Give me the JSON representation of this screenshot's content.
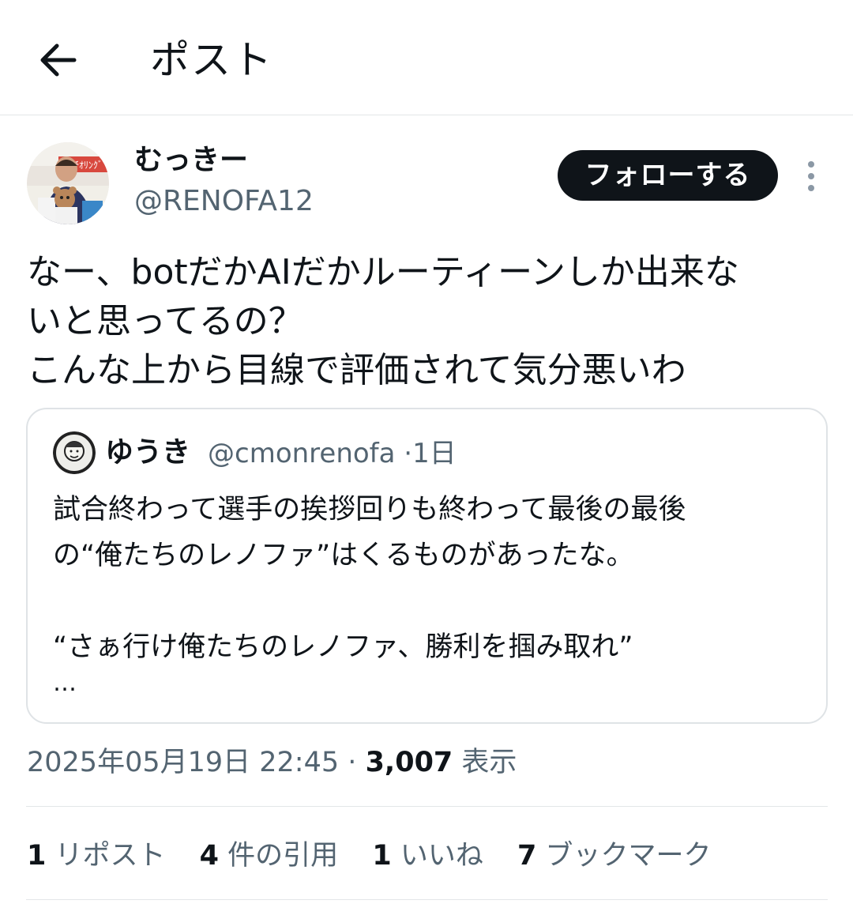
{
  "header": {
    "title": "ポスト",
    "back_icon": "arrow-left-icon"
  },
  "post": {
    "author": {
      "display_name": "むっきー",
      "handle": "@RENOFA12"
    },
    "follow_label": "フォローする",
    "more_icon": "more-vertical-icon",
    "text": "なー、botだかAIだかルーティーンしか出来な\nいと思ってるの？\nこんな上から目線で評価されて気分悪いわ",
    "quote": {
      "display_name": "ゆうき",
      "handle": "@cmonrenofa",
      "time": "1日",
      "separator": "·",
      "text": "試合終わって選手の挨拶回りも終わって最後の最後\nの“俺たちのレノファ”はくるものがあったな。\n\n“さぁ行け俺たちのレノファ、勝利を掴み取れ”",
      "ellipsis": "…"
    },
    "timestamp": "2025年05月19日 22:45",
    "separator": "·",
    "views_count": "3,007",
    "views_label": "表示",
    "stats": [
      {
        "count": "1",
        "label": "リポスト"
      },
      {
        "count": "4",
        "label": "件の引用"
      },
      {
        "count": "1",
        "label": "いいね"
      },
      {
        "count": "7",
        "label": "ブックマーク"
      }
    ]
  }
}
